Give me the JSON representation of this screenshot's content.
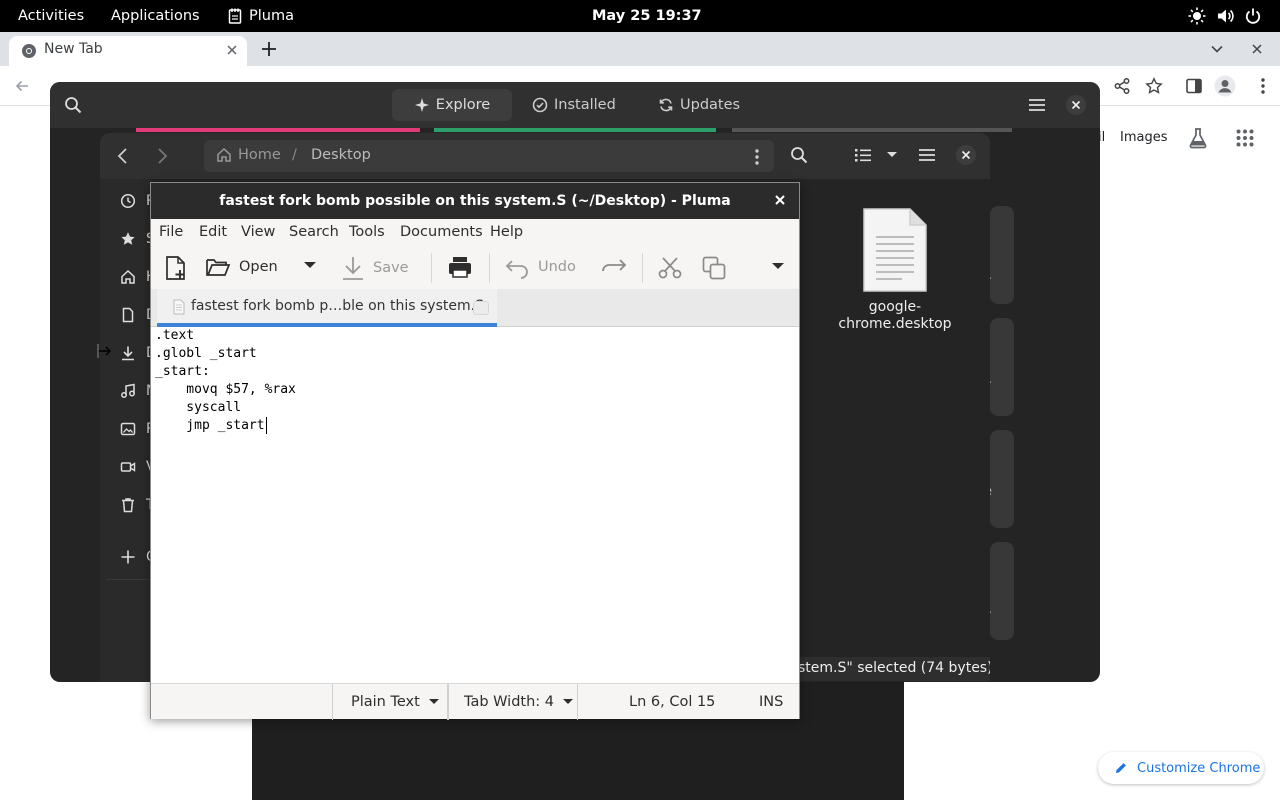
{
  "topbar": {
    "activities": "Activities",
    "applications": "Applications",
    "app_name": "Pluma",
    "clock": "May 25  19:37"
  },
  "chrome": {
    "tab_title": "New Tab",
    "gmail_fragment": "il",
    "images_link": "Images",
    "customize_label": "Customize Chrome",
    "accent": "#1a73e8"
  },
  "software": {
    "tabs": {
      "explore": "Explore",
      "installed": "Installed",
      "updates": "Updates"
    },
    "card_fragments": [
      ".",
      ".",
      "e",
      "."
    ]
  },
  "files": {
    "path": {
      "home": "Home",
      "separator": "/",
      "current": "Desktop"
    },
    "sidebar_fragments": [
      "R",
      "S",
      "H",
      "D",
      "D",
      "M",
      "P",
      "V",
      "T",
      "O"
    ],
    "desktop_file": {
      "name_line1": "google-",
      "name_line2": "chrome.desktop"
    },
    "status": "stem.S\" selected  (74 bytes)"
  },
  "pluma": {
    "title": "fastest fork bomb possible on this system.S (~/Desktop) - Pluma",
    "menu": {
      "file": "File",
      "edit": "Edit",
      "view": "View",
      "search": "Search",
      "tools": "Tools",
      "documents": "Documents",
      "help": "Help"
    },
    "toolbar": {
      "open": "Open",
      "save": "Save",
      "undo": "Undo"
    },
    "tab_label": "fastest fork bomb p…ble on this system.S",
    "code_lines": [
      ".text",
      ".globl _start",
      "_start:",
      "    movq $57, %rax",
      "    syscall",
      "    jmp _start"
    ],
    "statusbar": {
      "language": "Plain Text",
      "tab_width": "Tab Width:  4",
      "position": "Ln 6, Col 15",
      "mode": "INS"
    }
  }
}
